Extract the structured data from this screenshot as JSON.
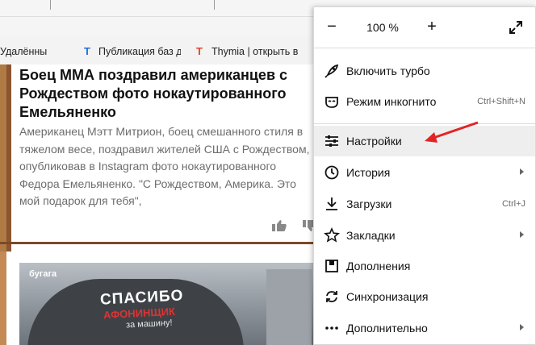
{
  "bookmarks": [
    {
      "label": "Удалённы",
      "icon": ""
    },
    {
      "label": "Публикация баз да",
      "icon": "T"
    },
    {
      "label": "Thymia | открыть в",
      "icon": "T"
    }
  ],
  "article": {
    "headline": "Боец ММА поздравил американцев с Рождеством фото нокаутированного Емельяненко",
    "lead": "Американец Мэтт Митрион, боец смешанного стиля в тяжелом весе, поздравил жителей США с Рождеством, опубликовав в Instagram фото нокаутированного Федора Емельяненко. \"С Рождеством, Америка. Это мой подарок для тебя\",",
    "photo": {
      "logo": "бугага",
      "sign_line1": "СПАСИБО",
      "sign_line2": "АФОНИНЩИК",
      "sign_line3": "за машину!"
    }
  },
  "menu": {
    "zoom": {
      "minus": "−",
      "value": "100 %",
      "plus": "+"
    },
    "items": [
      {
        "label": "Включить турбо",
        "icon": "rocket-icon",
        "shortcut": "",
        "submenu": false
      },
      {
        "label": "Режим инкогнито",
        "icon": "incognito-mask-icon",
        "shortcut": "Ctrl+Shift+N",
        "submenu": false
      },
      {
        "label": "Настройки",
        "icon": "sliders-icon",
        "shortcut": "",
        "submenu": false
      },
      {
        "label": "История",
        "icon": "clock-icon",
        "shortcut": "",
        "submenu": true
      },
      {
        "label": "Загрузки",
        "icon": "download-icon",
        "shortcut": "Ctrl+J",
        "submenu": false
      },
      {
        "label": "Закладки",
        "icon": "star-icon",
        "shortcut": "",
        "submenu": true
      },
      {
        "label": "Дополнения",
        "icon": "extensions-icon",
        "shortcut": "",
        "submenu": false
      },
      {
        "label": "Синхронизация",
        "icon": "sync-icon",
        "shortcut": "",
        "submenu": false
      },
      {
        "label": "Дополнительно",
        "icon": "more-dots-icon",
        "shortcut": "",
        "submenu": true
      }
    ]
  },
  "colors": {
    "accent_arrow": "#e32424",
    "active_item": "#eeeeee",
    "article_border": "#b07a44"
  }
}
